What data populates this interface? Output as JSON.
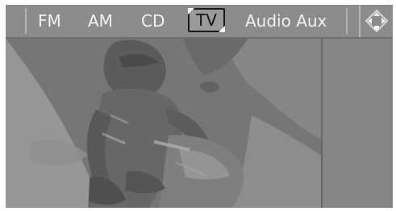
{
  "tabs": [
    {
      "label": "FM",
      "selected": false
    },
    {
      "label": "AM",
      "selected": false
    },
    {
      "label": "CD",
      "selected": false
    },
    {
      "label": "TV",
      "selected": true
    },
    {
      "label": "Audio Aux",
      "selected": false
    }
  ],
  "navigation": {
    "icon": "direction-pad-icon"
  },
  "video": {
    "content": "motocross-rider-image"
  },
  "colors": {
    "screen_bg": "#858585",
    "tab_text": "#f2f2f2",
    "selected_tab_border": "#1a1a1a"
  }
}
